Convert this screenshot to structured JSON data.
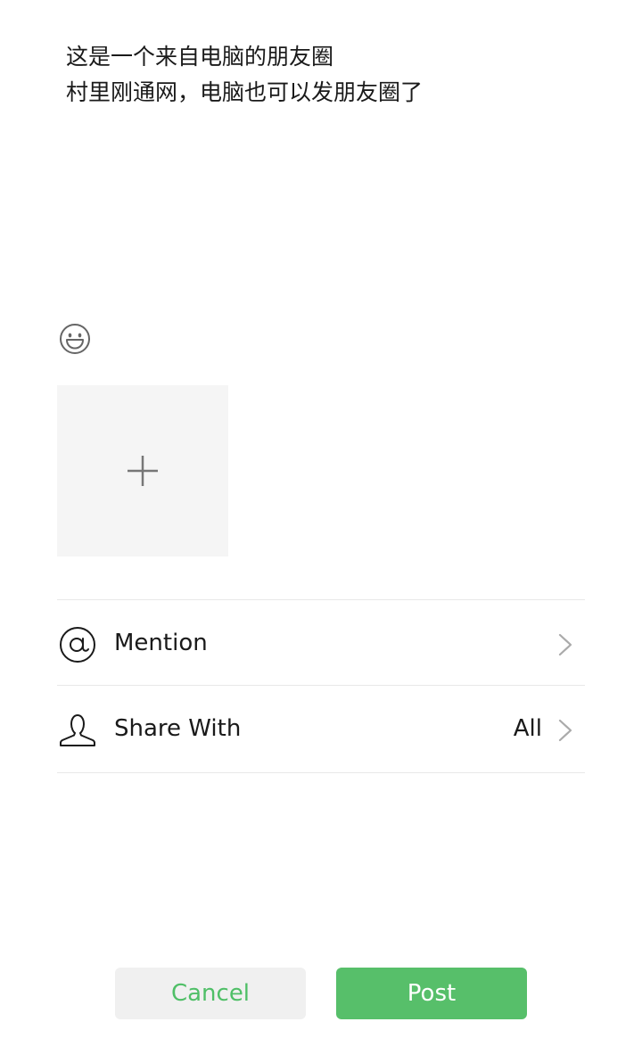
{
  "compose": {
    "lines": [
      "这是一个来自电脑的朋友圈",
      "村里刚通网，电脑也可以发朋友圈了"
    ]
  },
  "toolbar": {
    "emoji_icon": "smiley-face-icon",
    "add_photo_icon": "plus-icon"
  },
  "options": {
    "mention": {
      "label": "Mention",
      "icon": "at-sign-icon"
    },
    "share_with": {
      "label": "Share With",
      "value": "All",
      "icon": "person-outline-icon"
    }
  },
  "actions": {
    "cancel_label": "Cancel",
    "post_label": "Post"
  },
  "colors": {
    "accent": "#57bf6a",
    "cancel_text": "#4fbf67",
    "cancel_bg": "#f0f0f0",
    "placeholder_bg": "#f5f5f5",
    "divider": "#e8e8e8",
    "icon_gray": "#666666"
  }
}
